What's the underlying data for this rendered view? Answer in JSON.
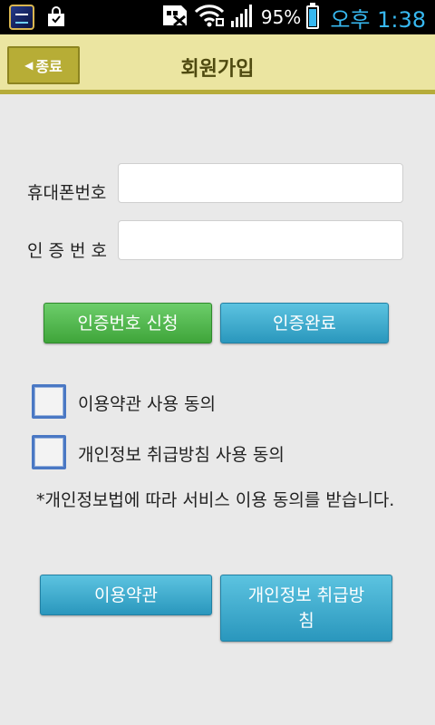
{
  "status_bar": {
    "icons": [
      "app-thumbnail-icon",
      "shopping-bag-icon",
      "sim-card-icon",
      "wifi-icon",
      "signal-icon",
      "battery-icon"
    ],
    "battery_percent": "95%",
    "battery_level": 0.95,
    "time": "오후 1:38",
    "time_color": "#37b8f0"
  },
  "header": {
    "back_label": "종료",
    "title": "회원가입",
    "accent_color": "#b7ad36"
  },
  "form": {
    "phone_label": "휴대폰번호",
    "phone_value": "",
    "code_label": "인 증 번 호",
    "code_value": ""
  },
  "buttons": {
    "request_code": "인증번호 신청",
    "verify_complete": "인증완료",
    "terms": "이용약관",
    "privacy_policy": "개인정보 취급방\n침"
  },
  "agreements": {
    "terms_label": "이용약관 사용 동의",
    "terms_checked": false,
    "privacy_label": "개인정보 취급방침 사용 동의",
    "privacy_checked": false,
    "notice": "*개인정보법에 따라 서비스 이용 동의를 받습니다."
  },
  "colors": {
    "green_button": "#3fa53a",
    "blue_button": "#2a97bd",
    "checkbox_border": "#4a78c4"
  }
}
